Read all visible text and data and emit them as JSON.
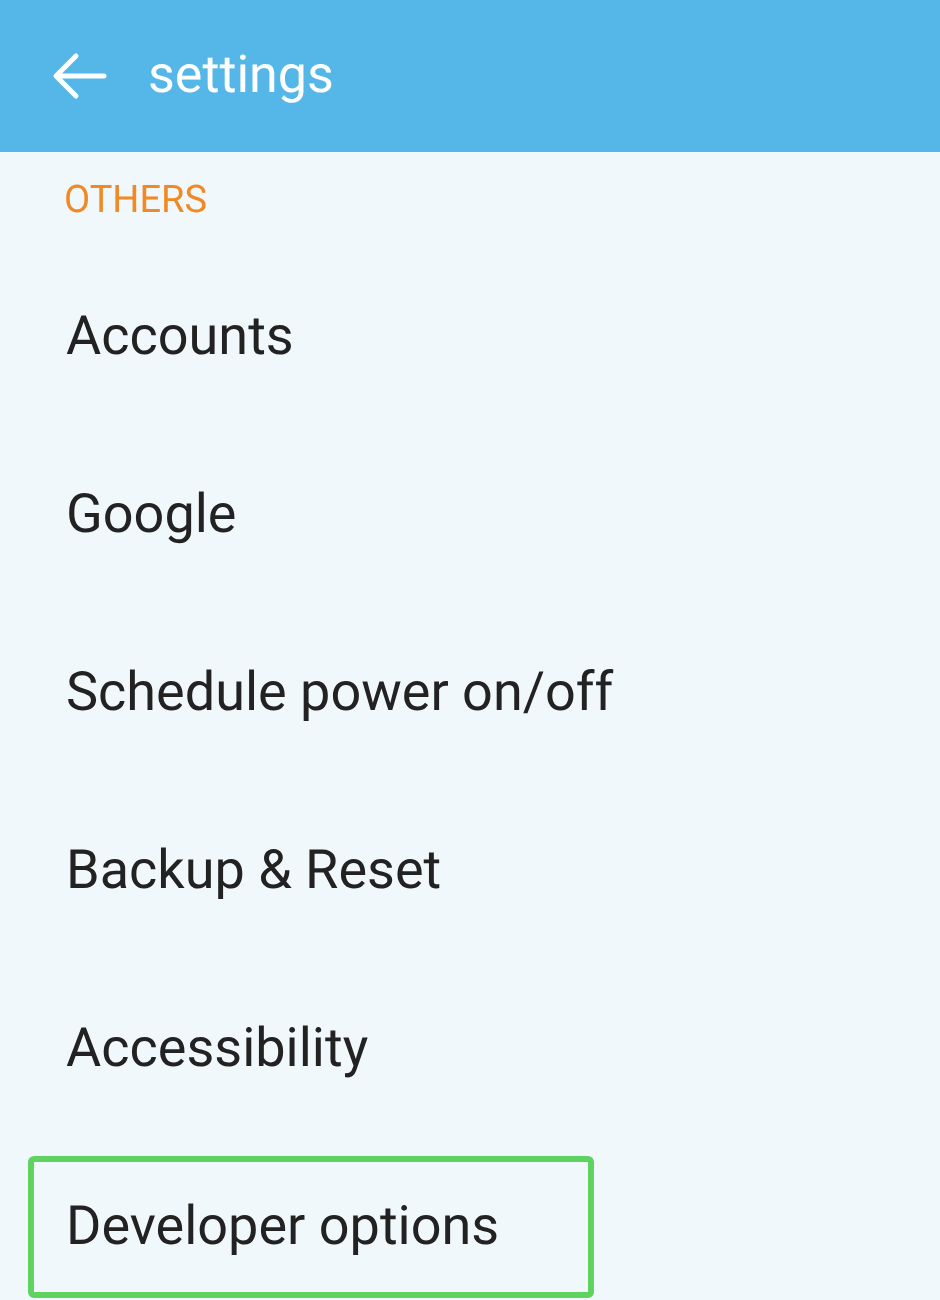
{
  "header": {
    "title": "settings"
  },
  "section": {
    "title": "OTHERS"
  },
  "items": [
    {
      "label": "Accounts",
      "highlighted": false
    },
    {
      "label": "Google",
      "highlighted": false
    },
    {
      "label": "Schedule power on/off",
      "highlighted": false
    },
    {
      "label": "Backup & Reset",
      "highlighted": false
    },
    {
      "label": "Accessibility",
      "highlighted": false
    },
    {
      "label": "Developer options",
      "highlighted": true
    }
  ]
}
